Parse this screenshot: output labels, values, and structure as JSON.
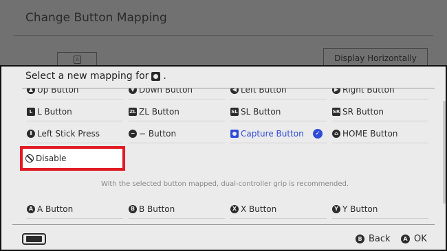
{
  "background": {
    "title": "Change Button Mapping",
    "icon_box_glyph": "A",
    "display_button_label": "Display Horizontally"
  },
  "dialog": {
    "header": "Select a new mapping for",
    "header_suffix": ".",
    "options": [
      {
        "label": "Up Button",
        "icon": "up-arrow-circle-icon",
        "glyph": "▲"
      },
      {
        "label": "Down Button",
        "icon": "down-arrow-circle-icon",
        "glyph": "▼"
      },
      {
        "label": "Left Button",
        "icon": "left-arrow-circle-icon",
        "glyph": "◀"
      },
      {
        "label": "Right Button",
        "icon": "right-arrow-circle-icon",
        "glyph": "▶"
      },
      {
        "label": "L Button",
        "icon": "l-button-icon",
        "glyph": "L"
      },
      {
        "label": "ZL Button",
        "icon": "zl-button-icon",
        "glyph": "ZL"
      },
      {
        "label": "SL Button",
        "icon": "sl-button-icon",
        "glyph": "SL"
      },
      {
        "label": "SR Button",
        "icon": "sr-button-icon",
        "glyph": "SR"
      },
      {
        "label": "Left Stick Press",
        "icon": "left-stick-icon",
        "glyph": "⬇"
      },
      {
        "label": "− Button",
        "icon": "minus-button-icon",
        "glyph": "−"
      },
      {
        "label": "Capture Button",
        "icon": "capture-button-icon",
        "glyph": "",
        "selected": true
      },
      {
        "label": "HOME Button",
        "icon": "home-button-icon",
        "glyph": "⌂"
      },
      {
        "label": "Disable",
        "icon": "disable-icon",
        "glyph": ""
      },
      {
        "label": "A Button",
        "icon": "a-button-icon",
        "glyph": "A"
      },
      {
        "label": "B Button",
        "icon": "b-button-icon",
        "glyph": "B"
      },
      {
        "label": "X Button",
        "icon": "x-button-icon",
        "glyph": "X"
      },
      {
        "label": "Y Button",
        "icon": "y-button-icon",
        "glyph": "Y"
      }
    ],
    "notice": "With the selected button mapped, dual-controller grip is recommended.",
    "selected_check_glyph": "✓"
  },
  "footer": {
    "back_label": "Back",
    "back_glyph": "B",
    "ok_label": "OK",
    "ok_glyph": "A"
  },
  "colors": {
    "accent": "#2f4bd8",
    "highlight": "#e01b24",
    "dialog_bg": "#ebebeb",
    "overlay": "#717171"
  }
}
